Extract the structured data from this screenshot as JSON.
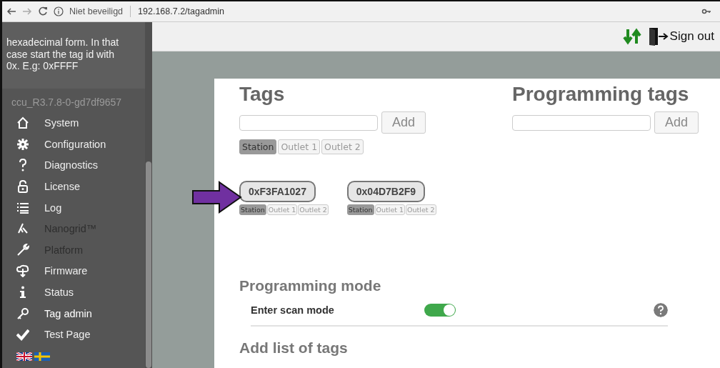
{
  "browser": {
    "security": "Niet beveiligd",
    "url": "192.168.7.2/tagadmin"
  },
  "sidebar": {
    "help_text": "hexadecimal form. In that case start the tag id with 0x. E.g: 0xFFFF",
    "version": "ccu_R3.7.8-0-gd7df9657",
    "items": [
      {
        "kind": "home",
        "label": "System",
        "selected": false,
        "dimmed": false
      },
      {
        "kind": "gear",
        "label": "Configuration",
        "selected": false,
        "dimmed": false
      },
      {
        "kind": "question",
        "label": "Diagnostics",
        "selected": false,
        "dimmed": false
      },
      {
        "kind": "lock",
        "label": "License",
        "selected": false,
        "dimmed": false
      },
      {
        "kind": "list",
        "label": "Log",
        "selected": false,
        "dimmed": false
      },
      {
        "kind": "network",
        "label": "Nanogrid™",
        "selected": false,
        "dimmed": true
      },
      {
        "kind": "wrench",
        "label": "Platform",
        "selected": false,
        "dimmed": true
      },
      {
        "kind": "cloud",
        "label": "Firmware",
        "selected": false,
        "dimmed": false
      },
      {
        "kind": "info",
        "label": "Status",
        "selected": false,
        "dimmed": false
      },
      {
        "kind": "key",
        "label": "Tag admin",
        "selected": true,
        "dimmed": false
      },
      {
        "kind": "check",
        "label": "Test Page",
        "selected": false,
        "dimmed": false
      }
    ]
  },
  "header": {
    "sign_out": "Sign out"
  },
  "tags": {
    "title": "Tags",
    "add": "Add",
    "filters": [
      {
        "label": "Station",
        "selected": true
      },
      {
        "label": "Outlet 1",
        "selected": false
      },
      {
        "label": "Outlet 2",
        "selected": false
      }
    ],
    "items": [
      {
        "id": "0xF3FA1027",
        "highlighted": true,
        "outlets": [
          {
            "label": "Station",
            "selected": true
          },
          {
            "label": "Outlet 1",
            "selected": false
          },
          {
            "label": "Outlet 2",
            "selected": false
          }
        ]
      },
      {
        "id": "0x04D7B2F9",
        "highlighted": false,
        "outlets": [
          {
            "label": "Station",
            "selected": true
          },
          {
            "label": "Outlet 1",
            "selected": false
          },
          {
            "label": "Outlet 2",
            "selected": false
          }
        ]
      }
    ]
  },
  "programming_tags": {
    "title": "Programming tags",
    "add": "Add"
  },
  "programming_mode": {
    "title": "Programming mode",
    "label": "Enter scan mode",
    "on": true
  },
  "add_list": {
    "title": "Add list of tags"
  }
}
